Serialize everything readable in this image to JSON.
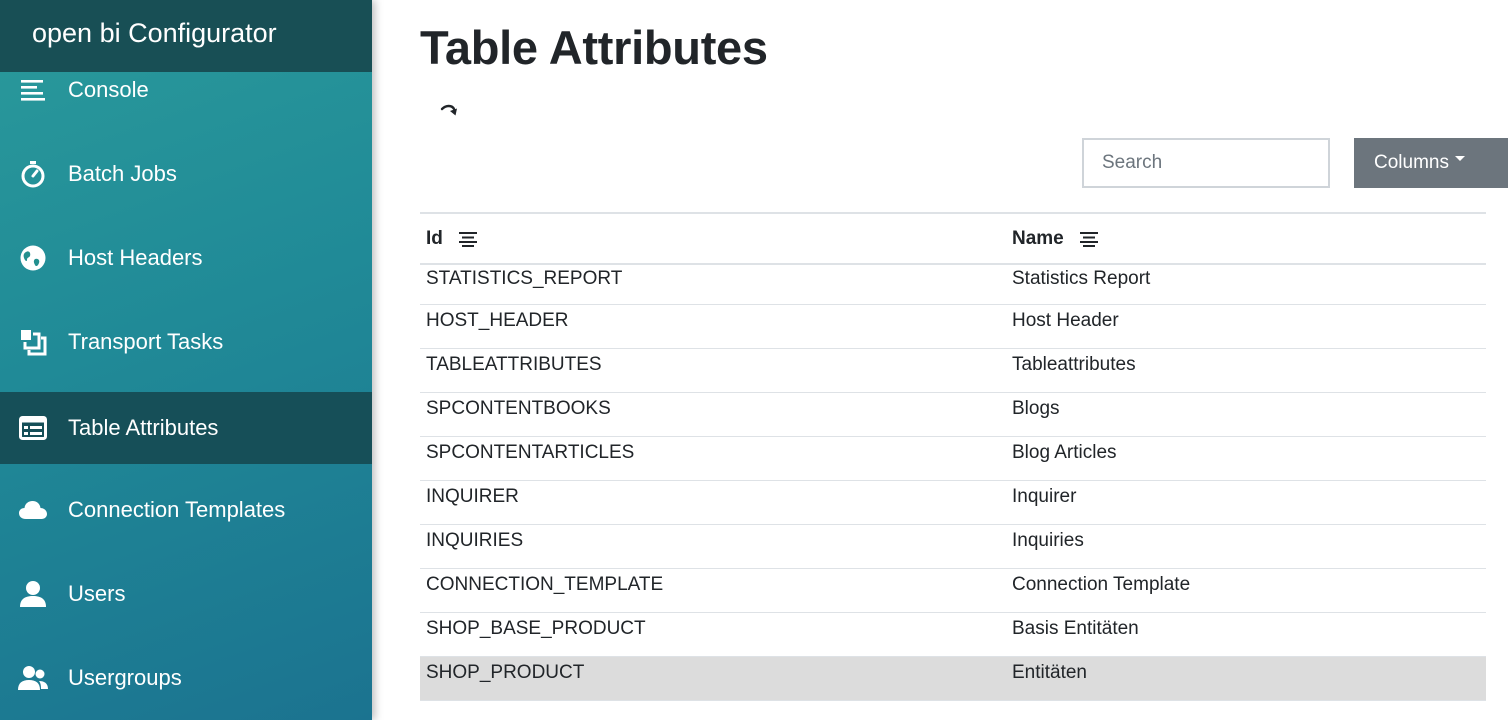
{
  "app": {
    "brand": "open bi Configurator"
  },
  "sidebar": {
    "items": [
      {
        "label": "Console",
        "icon": "list-lines-icon"
      },
      {
        "label": "Batch Jobs",
        "icon": "stopwatch-icon"
      },
      {
        "label": "Host Headers",
        "icon": "globe-icon"
      },
      {
        "label": "Transport Tasks",
        "icon": "stacked-squares-icon"
      },
      {
        "label": "Table Attributes",
        "icon": "table-icon",
        "active": true
      },
      {
        "label": "Connection Templates",
        "icon": "cloud-icon"
      },
      {
        "label": "Users",
        "icon": "user-icon"
      },
      {
        "label": "Usergroups",
        "icon": "users-icon"
      }
    ]
  },
  "main": {
    "title": "Table Attributes",
    "toolbar": {
      "search_placeholder": "Search",
      "columns_label": "Columns"
    },
    "table": {
      "headers": {
        "id": "Id",
        "name": "Name"
      },
      "rows": [
        {
          "id": "STATISTICS_REPORT",
          "name": "Statistics Report"
        },
        {
          "id": "HOST_HEADER",
          "name": "Host Header"
        },
        {
          "id": "TABLEATTRIBUTES",
          "name": "Tableattributes"
        },
        {
          "id": "SPCONTENTBOOKS",
          "name": "Blogs"
        },
        {
          "id": "SPCONTENTARTICLES",
          "name": "Blog Articles"
        },
        {
          "id": "INQUIRER",
          "name": "Inquirer"
        },
        {
          "id": "INQUIRIES",
          "name": "Inquiries"
        },
        {
          "id": "CONNECTION_TEMPLATE",
          "name": "Connection Template"
        },
        {
          "id": "SHOP_BASE_PRODUCT",
          "name": "Basis Entitäten"
        },
        {
          "id": "SHOP_PRODUCT",
          "name": "Entitäten",
          "highlighted": true
        }
      ]
    }
  },
  "colors": {
    "sidebar_gradient_start": "#2a9a9b",
    "sidebar_gradient_end": "#1b7390",
    "sidebar_header": "#184f55",
    "sidebar_active": "#164f58",
    "columns_button": "#6c757d",
    "row_highlight": "#dcdcdc"
  }
}
